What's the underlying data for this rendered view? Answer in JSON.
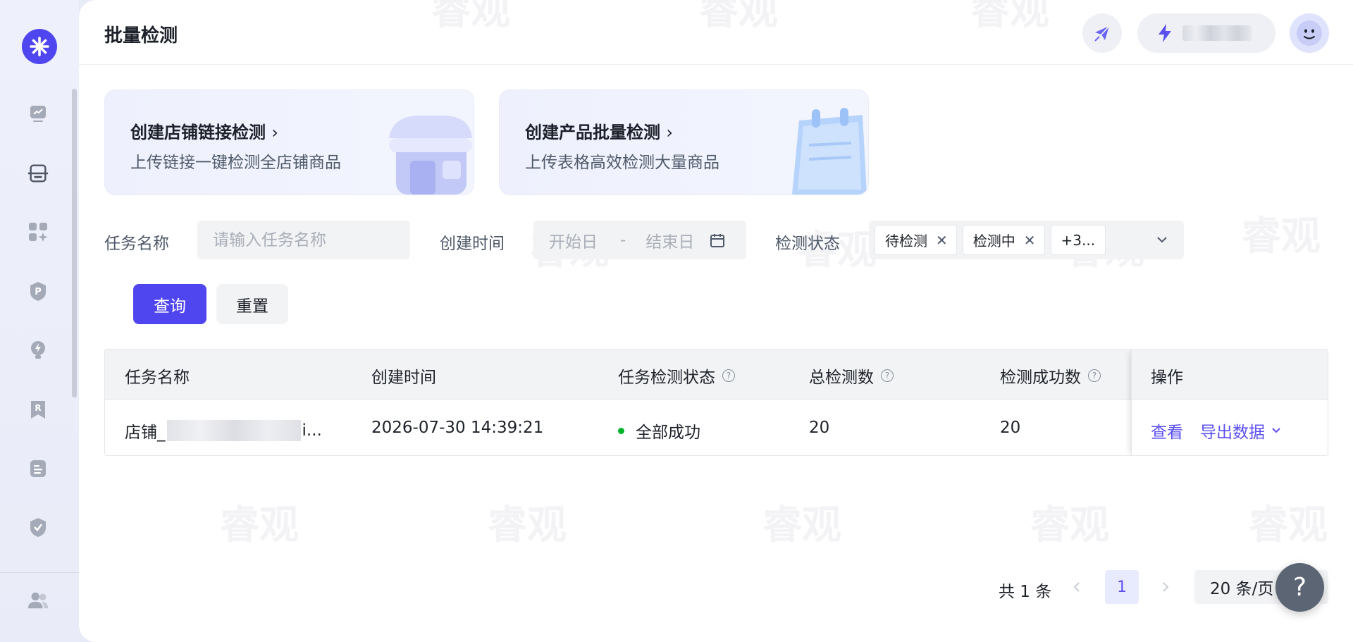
{
  "header": {
    "title": "批量检测"
  },
  "cards": [
    {
      "title": "创建店铺链接检测",
      "desc": "上传链接一键检测全店铺商品"
    },
    {
      "title": "创建产品批量检测",
      "desc": "上传表格高效检测大量商品"
    }
  ],
  "filters": {
    "task_name_label": "任务名称",
    "task_name_placeholder": "请输入任务名称",
    "created_time_label": "创建时间",
    "start_placeholder": "开始日",
    "range_sep": "-",
    "end_placeholder": "结束日",
    "status_label": "检测状态",
    "status_tags": [
      "待检测",
      "检测中"
    ],
    "status_more": "+3...",
    "query_button": "查询",
    "reset_button": "重置"
  },
  "table": {
    "columns": [
      "任务名称",
      "创建时间",
      "任务检测状态",
      "总检测数",
      "检测成功数",
      "操作"
    ],
    "rows": [
      {
        "name_prefix": "店铺_",
        "name_suffix": "i...",
        "created": "2026-07-30 14:39:21",
        "status": "全部成功",
        "total": "20",
        "success": "20",
        "action_view": "查看",
        "action_export": "导出数据"
      }
    ]
  },
  "pagination": {
    "total": "共 1 条",
    "current_page": "1",
    "page_size": "20 条/页"
  },
  "watermark": "睿观",
  "colors": {
    "accent": "#5046f0",
    "link": "#5b4ff0",
    "success": "#00b42a"
  }
}
